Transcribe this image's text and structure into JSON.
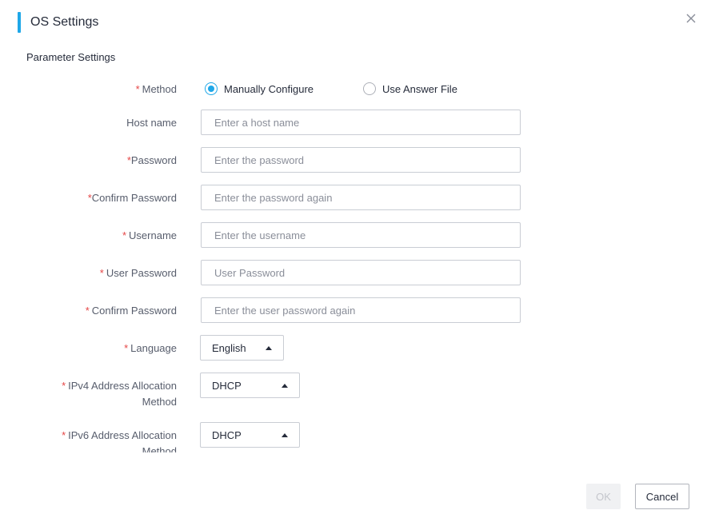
{
  "dialog": {
    "title": "OS Settings",
    "section_title": "Parameter Settings",
    "accent_color": "#1fa7e8"
  },
  "form": {
    "method": {
      "label": "Method",
      "options": [
        {
          "label": "Manually Configure",
          "checked": true
        },
        {
          "label": "Use Answer File",
          "checked": false
        }
      ]
    },
    "host_name": {
      "label": "Host name",
      "placeholder": "Enter a host name"
    },
    "password": {
      "label": "Password",
      "placeholder": "Enter the password"
    },
    "confirm_password": {
      "label": "Confirm Password",
      "placeholder": "Enter the password again"
    },
    "username": {
      "label": "Username",
      "placeholder": "Enter the username"
    },
    "user_password": {
      "label": "User Password",
      "placeholder": "User Password"
    },
    "confirm_user_password": {
      "label": "Confirm Password",
      "placeholder": "Enter the user password again"
    },
    "language": {
      "label": "Language",
      "value": "English"
    },
    "ipv4": {
      "label_line1": "IPv4 Address Allocation",
      "label_line2": "Method",
      "value": "DHCP"
    },
    "ipv6": {
      "label_line1": "IPv6 Address Allocation",
      "label_line2": "Method",
      "value": "DHCP"
    },
    "required_mark": "*"
  },
  "footer": {
    "ok_label": "OK",
    "cancel_label": "Cancel"
  },
  "icons": {
    "close": "close-icon",
    "dropdown": "caret-up-icon"
  }
}
